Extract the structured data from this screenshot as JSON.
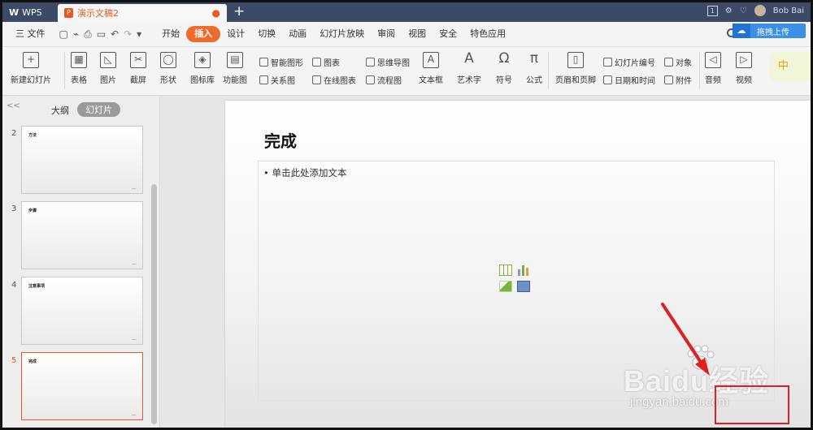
{
  "window": {
    "app_tab": "WPS",
    "doc_tab": "演示文稿2",
    "new_tab": "+",
    "user_name": "Bob Bai"
  },
  "menubar": {
    "file": "三 文件",
    "items": [
      "开始",
      "插入",
      "设计",
      "切换",
      "动画",
      "幻灯片放映",
      "审阅",
      "视图",
      "安全",
      "特色应用"
    ],
    "active": "插入",
    "upload": "拖拽上传"
  },
  "ribbon": {
    "new_slide": "新建幻灯片",
    "table": "表格",
    "picture": "图片",
    "screenshot": "截屏",
    "shape": "形状",
    "icon_lib": "图标库",
    "func_chart": "功能图",
    "smart_shape": "智能图形",
    "chart": "图表",
    "relation": "关系图",
    "online_chart": "在线图表",
    "mindmap": "思维导图",
    "flowchart": "流程图",
    "textbox": "文本框",
    "wordart": "艺术字",
    "symbol": "符号",
    "formula": "公式",
    "header_footer": "页眉和页脚",
    "slide_number": "幻灯片编号",
    "object": "对象",
    "datetime": "日期和时间",
    "attachment": "附件",
    "audio": "音频",
    "video": "视频",
    "ime": "中"
  },
  "panel": {
    "collapse": "<<",
    "tab_outline": "大纲",
    "tab_slides": "幻灯片",
    "thumbnails": [
      {
        "num": "2",
        "title": "方法"
      },
      {
        "num": "3",
        "title": "步骤"
      },
      {
        "num": "4",
        "title": "注意事项"
      },
      {
        "num": "5",
        "title": "完成"
      }
    ],
    "selected": "5"
  },
  "slide": {
    "title": "完成",
    "placeholder": "•  单击此处添加文本"
  },
  "watermark": {
    "main": "Baidu经验",
    "sub": "jingyan.baidu.com"
  },
  "colors": {
    "accent": "#ef6b2c",
    "titlebar": "#3b4a66",
    "annotation": "#e02020"
  }
}
